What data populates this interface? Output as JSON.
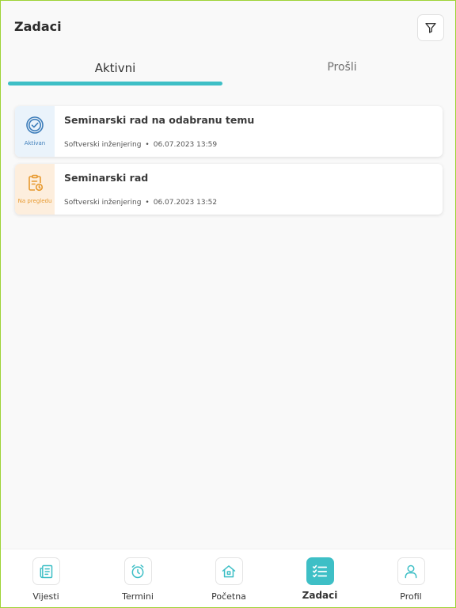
{
  "header": {
    "title": "Zadaci",
    "filter_icon": "filter-icon"
  },
  "tabs": [
    {
      "label": "Aktivni",
      "active": true
    },
    {
      "label": "Prošli",
      "active": false
    }
  ],
  "tasks": [
    {
      "title": "Seminarski rad na odabranu temu",
      "status": "Aktivan",
      "status_icon": "check-circle-icon",
      "course": "Softverski inženjering",
      "separator": "•",
      "datetime": "06.07.2023 13:59"
    },
    {
      "title": "Seminarski rad",
      "status": "Na pregledu",
      "status_icon": "clipboard-clock-icon",
      "course": "Softverski inženjering",
      "separator": "•",
      "datetime": "06.07.2023 13:52"
    }
  ],
  "bottom_nav": [
    {
      "label": "Vijesti",
      "icon": "news-icon",
      "active": false
    },
    {
      "label": "Termini",
      "icon": "alarm-clock-icon",
      "active": false
    },
    {
      "label": "Početna",
      "icon": "home-icon",
      "active": false
    },
    {
      "label": "Zadaci",
      "icon": "checklist-icon",
      "active": true
    },
    {
      "label": "Profil",
      "icon": "user-icon",
      "active": false
    }
  ],
  "colors": {
    "accent": "#3ebfc6",
    "status_active": "#3d7dba",
    "status_review": "#e7992e"
  }
}
